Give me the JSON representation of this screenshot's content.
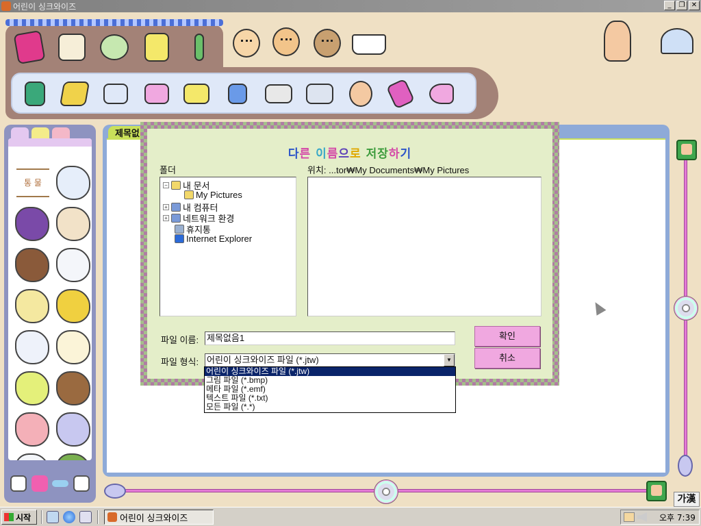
{
  "window": {
    "title": "어린이 싱크와이즈"
  },
  "doc": {
    "tab_label": "제목없"
  },
  "left_panel": {
    "category_label": "통 물"
  },
  "dialog": {
    "title_chars": [
      "다",
      "른",
      " ",
      "이",
      "름",
      "으",
      "로",
      " ",
      "저",
      "장",
      "하",
      "기"
    ],
    "title_colors": [
      "#2b54c8",
      "#d44aa8",
      "#000",
      "#37a8c8",
      "#d44aa8",
      "#5a3fb8",
      "#e0a800",
      "#000",
      "#3d9c3d",
      "#3d9c3d",
      "#d44aa8",
      "#2b54c8"
    ],
    "folder_label": "폴더",
    "location_label": "위치: ...tor₩My Documents₩My Pictures",
    "tree": [
      {
        "label": "내 문서",
        "expander": "⊟",
        "icon_color": "#f2d86a"
      },
      {
        "label": "My Pictures",
        "expander": "",
        "icon_color": "#f2d86a"
      },
      {
        "label": "내 컴퓨터",
        "expander": "⊞",
        "icon_color": "#7a9ad8"
      },
      {
        "label": "네트워크 환경",
        "expander": "⊞",
        "icon_color": "#7a9ad8"
      },
      {
        "label": "휴지통",
        "expander": "",
        "icon_color": "#9ab0d0"
      },
      {
        "label": "Internet Explorer",
        "expander": "",
        "icon_color": "#2b6ad8"
      }
    ],
    "filename_label": "파일 이름:",
    "filename_value": "제목없음1",
    "filetype_label": "파일 형식:",
    "filetype_value": "어린이 싱크와이즈 파일 (*.jtw)",
    "ok_label": "확인",
    "cancel_label": "취소",
    "filetype_options": [
      "어린이 싱크와이즈 파일 (*.jtw)",
      "그림 파일 (*.bmp)",
      "메타 파일 (*.emf)",
      "텍스트 파일 (*.txt)",
      "모든 파일 (*.*)"
    ],
    "selected_option": 0
  },
  "ime": {
    "label": "가漢"
  },
  "taskbar": {
    "start_label": "시작",
    "task_label": "어린이 싱크와이즈",
    "clock": "오후 7:39"
  },
  "colors": {
    "accent_pink": "#e47ad6",
    "dialog_bg": "#e4eec9",
    "doc_green": "#c9e05a"
  }
}
